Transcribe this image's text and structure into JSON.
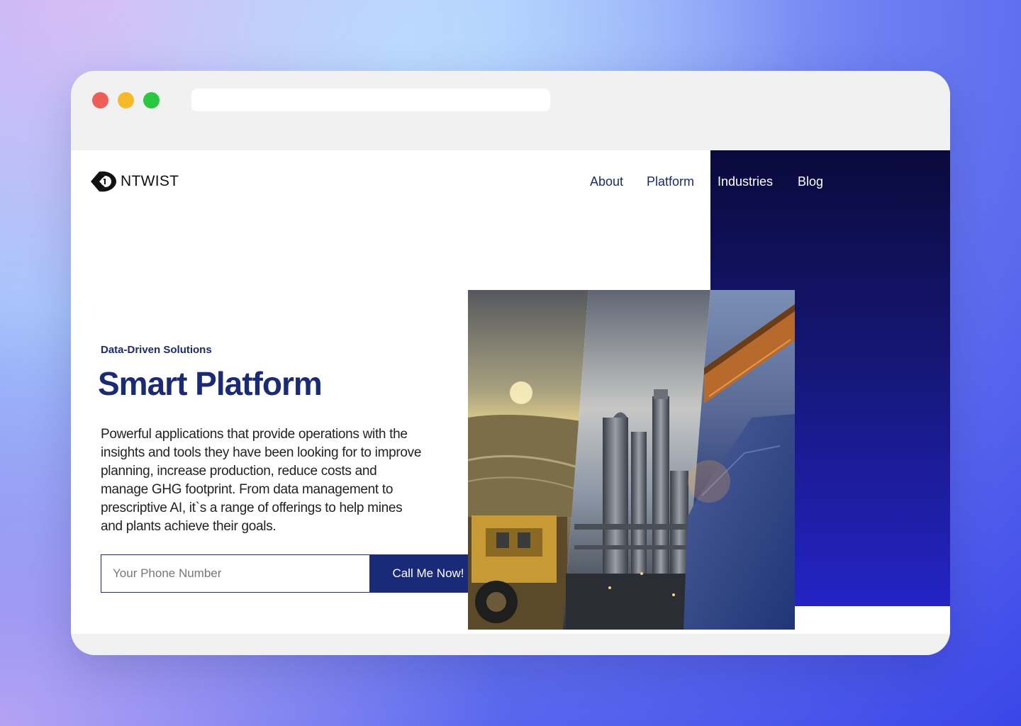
{
  "brand": {
    "name": "NTWIST",
    "logo_icon": "ntwist-logo-icon"
  },
  "nav": {
    "items": [
      {
        "label": "About"
      },
      {
        "label": "Platform"
      },
      {
        "label": "Industries"
      },
      {
        "label": "Blog"
      }
    ]
  },
  "hero": {
    "eyebrow": "Data-Driven Solutions",
    "title": "Smart Platform",
    "description": "Powerful applications that provide operations with the insights and tools they have been looking for to improve planning, increase production, reduce costs and manage GHG footprint. From data management to prescriptive AI, it`s a range of offerings to help mines and plants achieve their goals."
  },
  "cta": {
    "phone_placeholder": "Your Phone Number",
    "phone_value": "",
    "button_label": "Call Me Now!"
  },
  "colors": {
    "accent": "#1b2a74",
    "panel_top": "#0a0a3c",
    "panel_bottom": "#2423c6"
  }
}
